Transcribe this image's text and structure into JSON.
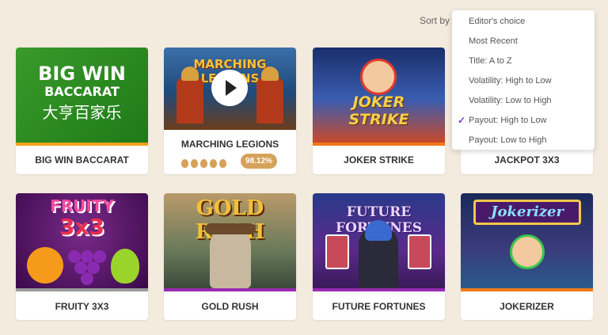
{
  "sort": {
    "label": "Sort by",
    "options": [
      "Editor's choice",
      "Most Recent",
      "Title: A to Z",
      "Volatility: High to Low",
      "Volatility: Low to High",
      "Payout: High to Low",
      "Payout: Low to High"
    ],
    "selected_index": 5
  },
  "games": [
    {
      "title": "BIG WIN BACCARAT",
      "logo_line1": "BIG WIN",
      "logo_line2": "BACCARAT",
      "logo_line3": "大亨百家乐",
      "bar_color": "#f3a21b"
    },
    {
      "title": "MARCHING LEGIONS",
      "logo": "MARCHING LEGIONS",
      "rating_of_5": 5,
      "payout": "98.12%",
      "bar_color": "#ffffff"
    },
    {
      "title": "JOKER STRIKE",
      "logo_line1": "JOKER",
      "logo_line2": "STRIKE",
      "bar_color": "#f07a1a"
    },
    {
      "title": "JACKPOT 3X3",
      "bar_color": "#f3a21b"
    },
    {
      "title": "FRUITY 3X3",
      "logo_line1": "FRUITY",
      "logo_line2": "3x3",
      "bar_color": "#9a9a9a"
    },
    {
      "title": "GOLD RUSH",
      "logo": "GOLD RUSH",
      "bar_color": "#9a2ab0"
    },
    {
      "title": "FUTURE FORTUNES",
      "logo": "FUTURE FORTUNES",
      "bar_color": "#9a2ab0"
    },
    {
      "title": "JOKERIZER",
      "logo": "Jokerizer",
      "bar_color": "#f07a1a"
    }
  ],
  "colors": {
    "background": "#f3ebde",
    "accent_badge": "#d6a25a",
    "check": "#7a3ad8"
  },
  "icons": {
    "play": "play-icon",
    "check": "check-icon",
    "rating": "drop-icon"
  }
}
